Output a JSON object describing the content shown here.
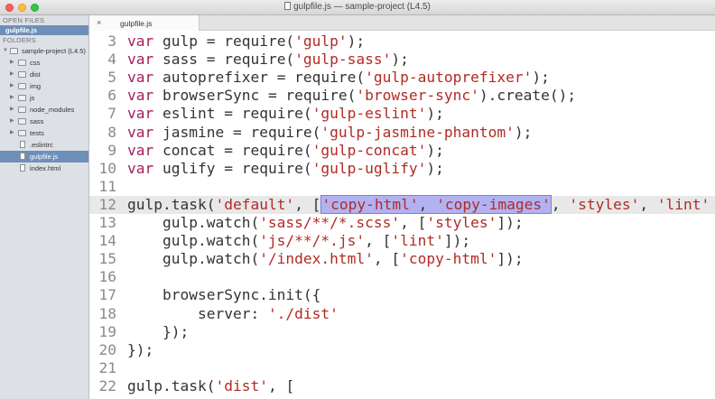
{
  "window": {
    "title": "gulpfile.js — sample-project (L4.5)"
  },
  "sidebar": {
    "open_files_header": "OPEN FILES",
    "open_file": "gulpfile.js",
    "folders_header": "FOLDERS",
    "project": "sample-project (L4.5)",
    "items": [
      {
        "label": "css",
        "kind": "folder"
      },
      {
        "label": "dist",
        "kind": "folder"
      },
      {
        "label": "img",
        "kind": "folder"
      },
      {
        "label": "js",
        "kind": "folder"
      },
      {
        "label": "node_modules",
        "kind": "folder"
      },
      {
        "label": "sass",
        "kind": "folder"
      },
      {
        "label": "tests",
        "kind": "folder"
      },
      {
        "label": ".eslintrc",
        "kind": "file"
      },
      {
        "label": "gulpfile.js",
        "kind": "file",
        "selected": true
      },
      {
        "label": "index.html",
        "kind": "file"
      }
    ]
  },
  "tab": {
    "close": "×",
    "label": "gulpfile.js"
  },
  "editor": {
    "lines": [
      {
        "n": "3",
        "t": "var gulp = require('gulp');"
      },
      {
        "n": "4",
        "t": "var sass = require('gulp-sass');"
      },
      {
        "n": "5",
        "t": "var autoprefixer = require('gulp-autoprefixer');"
      },
      {
        "n": "6",
        "t": "var browserSync = require('browser-sync').create();"
      },
      {
        "n": "7",
        "t": "var eslint = require('gulp-eslint');"
      },
      {
        "n": "8",
        "t": "var jasmine = require('gulp-jasmine-phantom');"
      },
      {
        "n": "9",
        "t": "var concat = require('gulp-concat');"
      },
      {
        "n": "10",
        "t": "var uglify = require('gulp-uglify');"
      },
      {
        "n": "11",
        "t": ""
      },
      {
        "n": "12",
        "t": "gulp.task('default', ['copy-html', 'copy-images', 'styles', 'lint'"
      },
      {
        "n": "13",
        "t": "    gulp.watch('sass/**/*.scss', ['styles']);"
      },
      {
        "n": "14",
        "t": "    gulp.watch('js/**/*.js', ['lint']);"
      },
      {
        "n": "15",
        "t": "    gulp.watch('/index.html', ['copy-html']);"
      },
      {
        "n": "16",
        "t": ""
      },
      {
        "n": "17",
        "t": "    browserSync.init({"
      },
      {
        "n": "18",
        "t": "        server: './dist'"
      },
      {
        "n": "19",
        "t": "    });"
      },
      {
        "n": "20",
        "t": "});"
      },
      {
        "n": "21",
        "t": ""
      },
      {
        "n": "22",
        "t": "gulp.task('dist', ["
      }
    ],
    "current_line": "12",
    "selection_text": "'copy-html', 'copy-images'"
  },
  "colors": {
    "keyword": "#a71d5d",
    "string": "#b12b24",
    "selection": "#b2b2f2"
  }
}
